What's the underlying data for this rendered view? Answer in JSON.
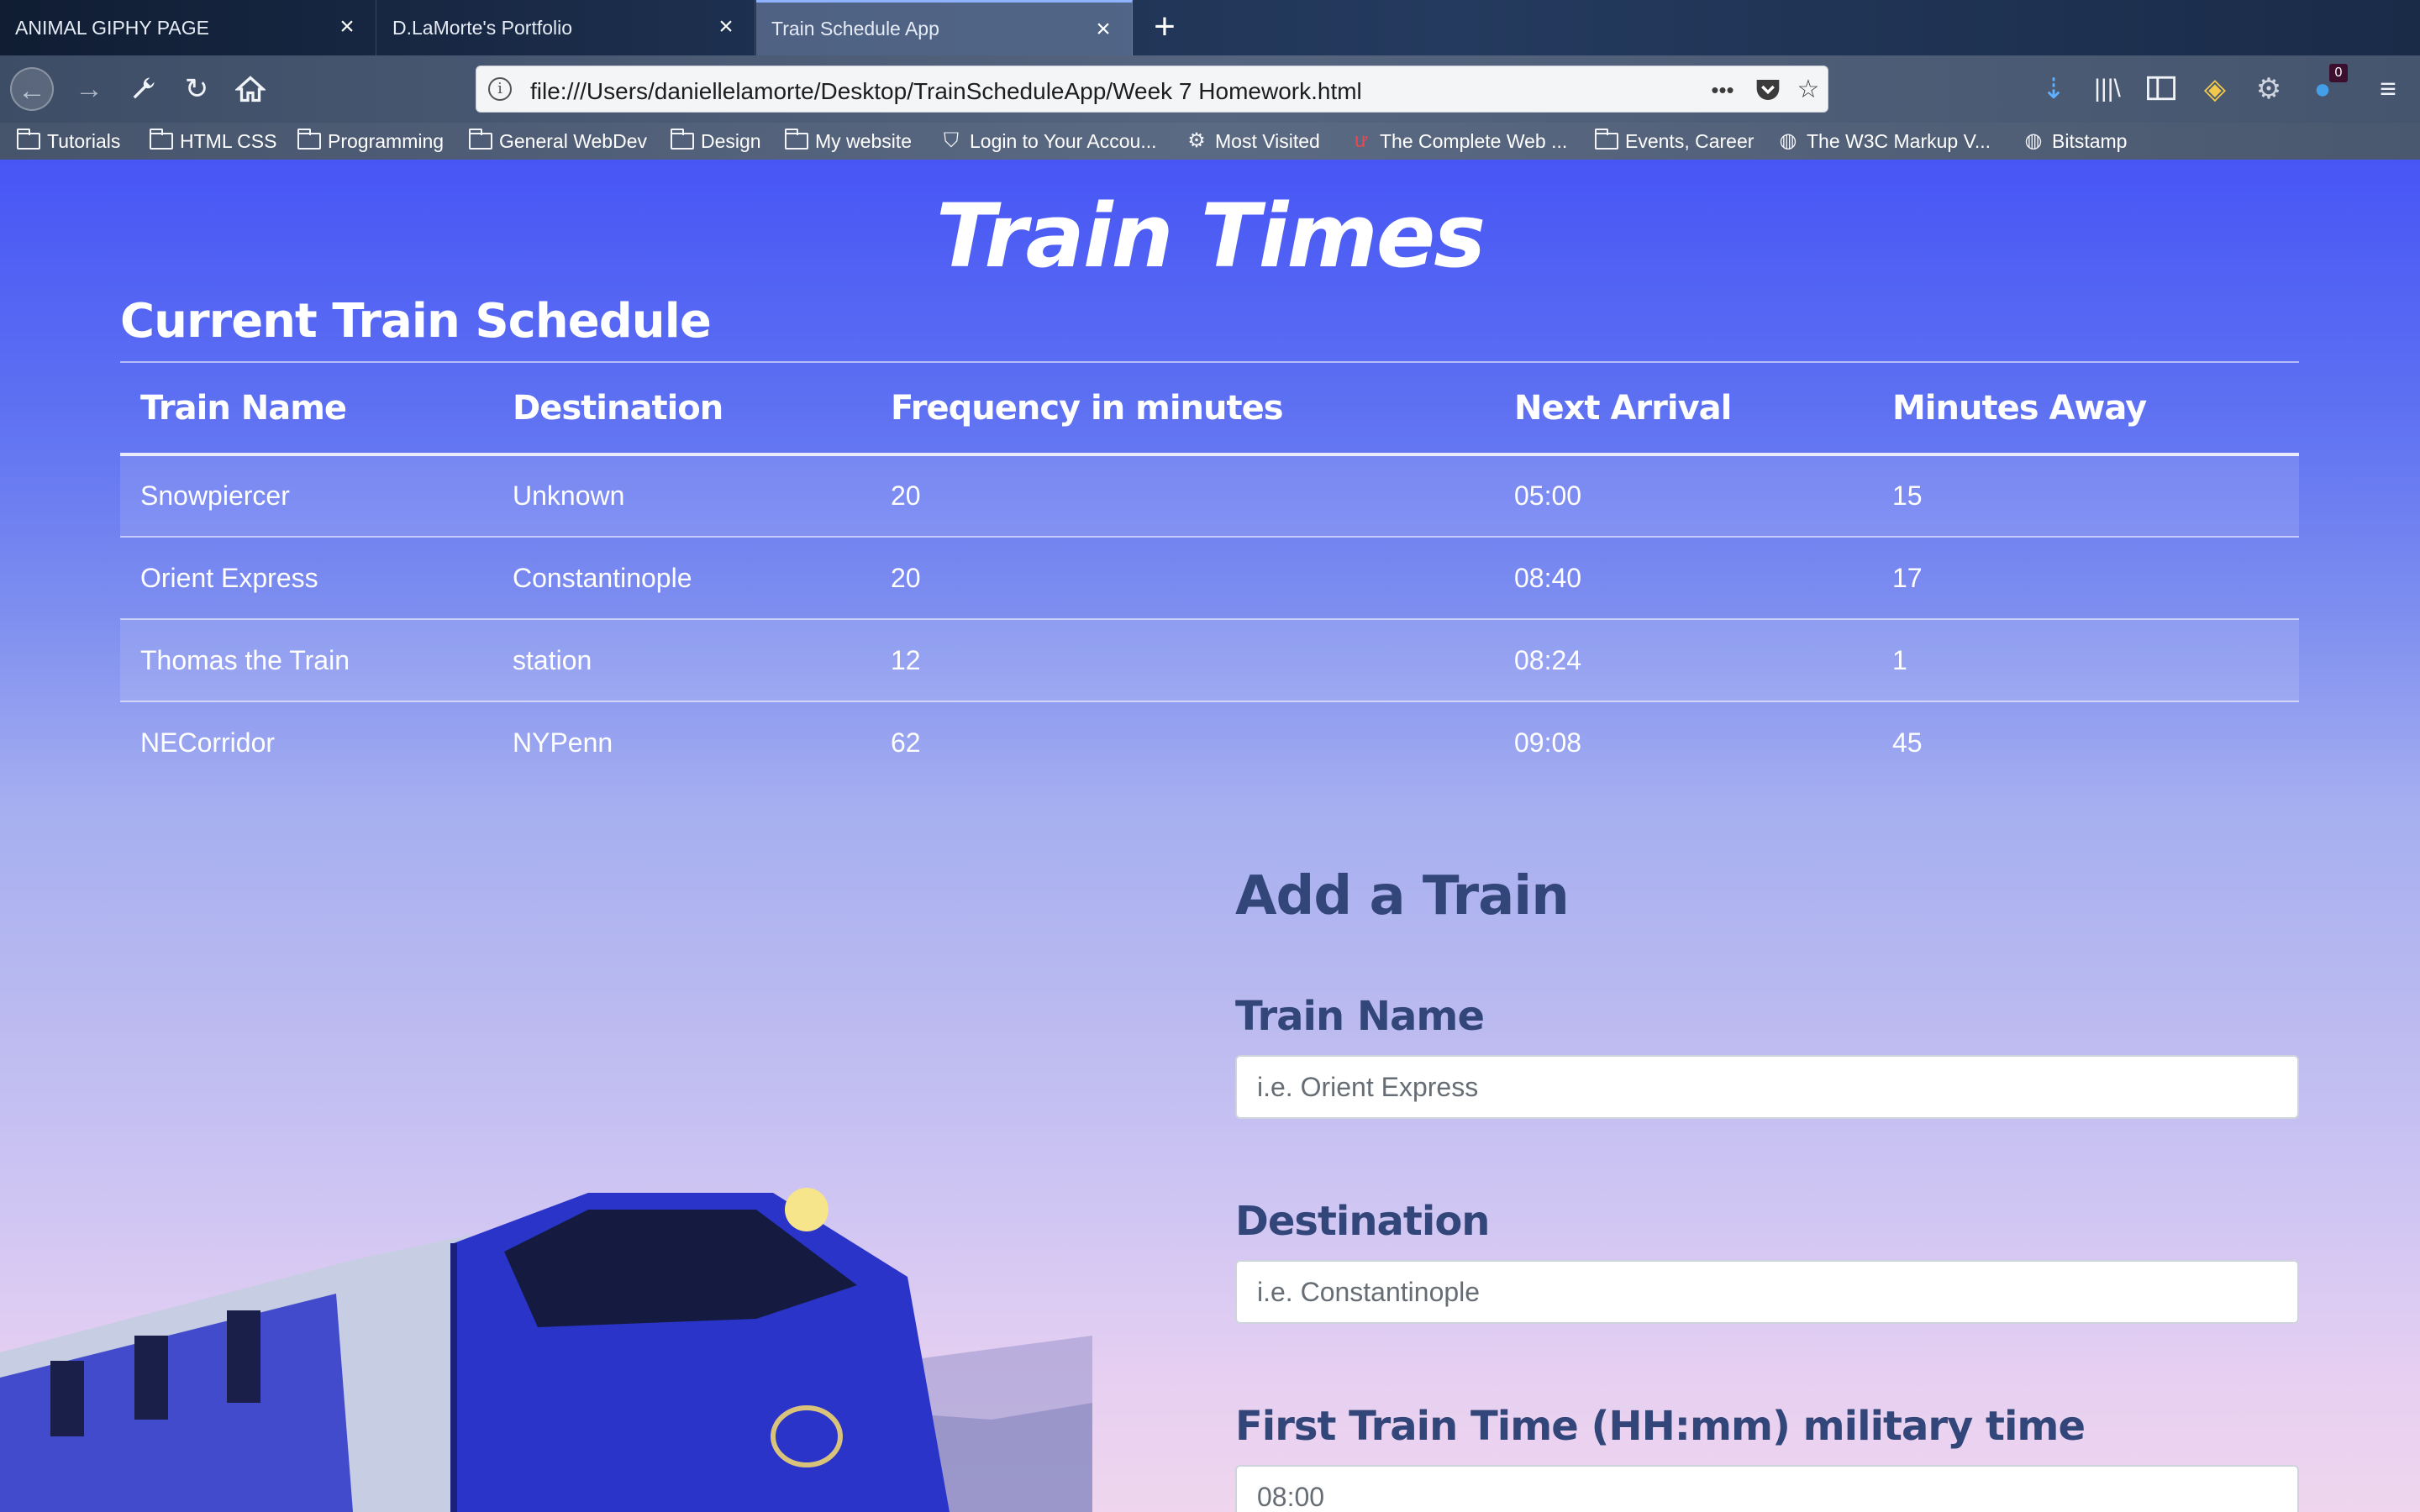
{
  "browser": {
    "tabs": [
      {
        "title": "ANIMAL GIPHY PAGE",
        "active": false
      },
      {
        "title": "D.LaMorte's Portfolio",
        "active": false
      },
      {
        "title": "Train Schedule App",
        "active": true
      }
    ],
    "url": "file:///Users/daniellelamorte/Desktop/TrainScheduleApp/Week 7 Homework.html",
    "page_actions_label": "•••",
    "extension_badge": "0",
    "bookmarks": [
      {
        "label": "Tutorials",
        "icon": "folder-icon"
      },
      {
        "label": "HTML CSS",
        "icon": "folder-icon"
      },
      {
        "label": "Programming",
        "icon": "folder-icon"
      },
      {
        "label": "General WebDev",
        "icon": "folder-icon"
      },
      {
        "label": "Design",
        "icon": "folder-icon"
      },
      {
        "label": "My website",
        "icon": "folder-icon"
      },
      {
        "label": "Login to Your Accou...",
        "icon": "pocket-icon"
      },
      {
        "label": "Most Visited",
        "icon": "gear-icon"
      },
      {
        "label": "The Complete Web ...",
        "icon": "udemy-icon"
      },
      {
        "label": "Events, Career",
        "icon": "folder-icon"
      },
      {
        "label": "The W3C Markup V...",
        "icon": "globe-icon"
      },
      {
        "label": "Bitstamp",
        "icon": "globe-icon"
      }
    ]
  },
  "page": {
    "title": "Train Times",
    "schedule_heading": "Current Train Schedule",
    "table": {
      "headers": [
        "Train Name",
        "Destination",
        "Frequency in minutes",
        "Next Arrival",
        "Minutes Away"
      ],
      "rows": [
        [
          "Snowpiercer",
          "Unknown",
          "20",
          "05:00",
          "15"
        ],
        [
          "Orient Express",
          "Constantinople",
          "20",
          "08:40",
          "17"
        ],
        [
          "Thomas the Train",
          "station",
          "12",
          "08:24",
          "1"
        ],
        [
          "NECorridor",
          "NYPenn",
          "62",
          "09:08",
          "45"
        ]
      ]
    },
    "form": {
      "heading": "Add a Train",
      "name_label": "Train Name",
      "name_placeholder": "i.e. Orient Express",
      "destination_label": "Destination",
      "destination_placeholder": "i.e. Constantinople",
      "first_time_label": "First Train Time (HH:mm) military time",
      "first_time_placeholder": "08:00"
    }
  },
  "colors": {
    "page_gradient_top": "#4756f5",
    "page_gradient_bottom": "#efd6ee",
    "form_heading": "#33467a",
    "train_body": "#2b34c9"
  }
}
